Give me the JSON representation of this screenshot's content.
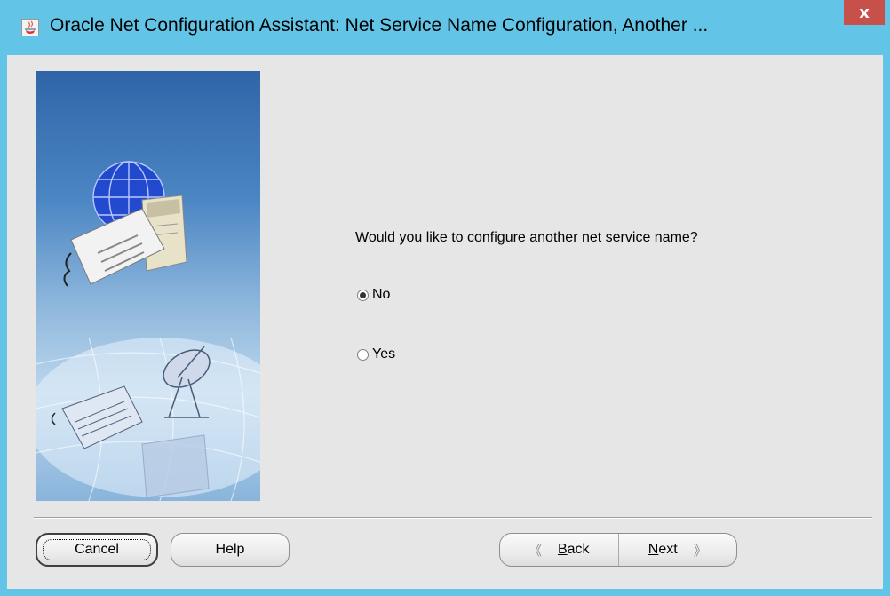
{
  "window": {
    "title": "Oracle Net Configuration Assistant: Net Service Name Configuration, Another ...",
    "close_glyph": "x"
  },
  "question": "Would you like to configure another net service name?",
  "options": [
    {
      "label": "No",
      "selected": true
    },
    {
      "label": "Yes",
      "selected": false
    }
  ],
  "buttons": {
    "cancel": "Cancel",
    "help": "Help",
    "back_mnemonic": "B",
    "back_rest": "ack",
    "next_mnemonic": "N",
    "next_rest": "ext"
  },
  "icons": {
    "app": "java-cup-icon",
    "close": "close-icon",
    "back": "chevron-left-icon",
    "next": "chevron-right-icon"
  },
  "colors": {
    "titlebar": "#62c4e7",
    "close": "#c7504b",
    "client": "#e6e6e6"
  }
}
